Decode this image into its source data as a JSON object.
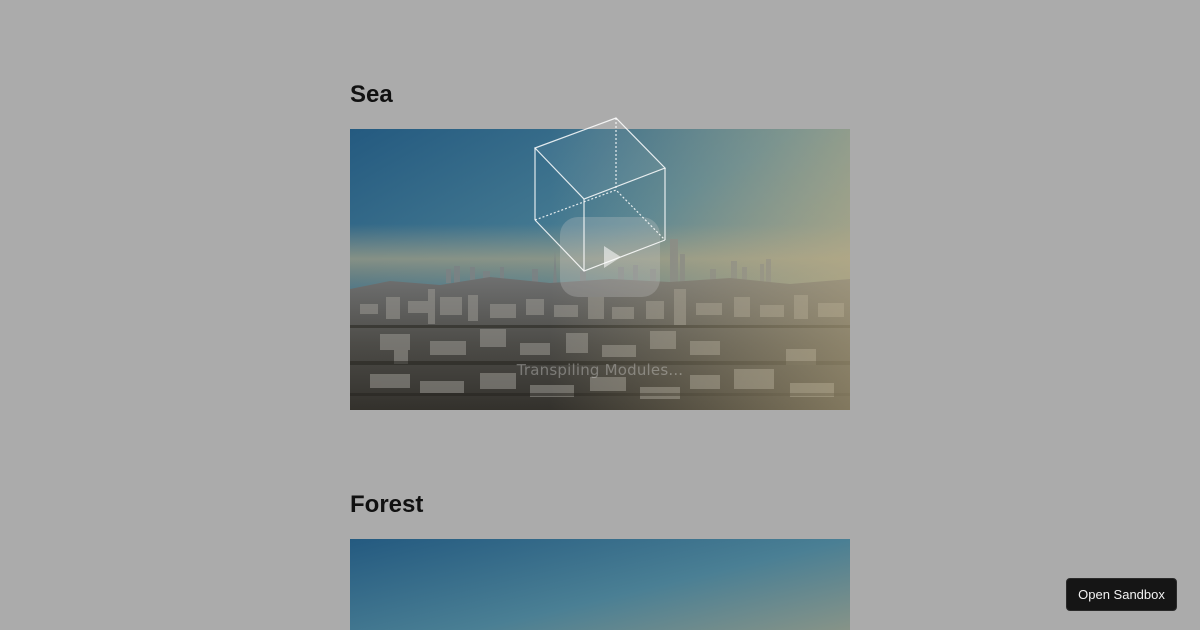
{
  "sections": [
    {
      "title": "Sea"
    },
    {
      "title": "Forest"
    }
  ],
  "loader": {
    "text": "Transpiling Modules..."
  },
  "sandbox_button": {
    "label": "Open Sandbox"
  },
  "colors": {
    "page_background": "#ababab",
    "sky_top": "#2c6185",
    "haze": "#a39a78",
    "button_background": "#151515"
  }
}
